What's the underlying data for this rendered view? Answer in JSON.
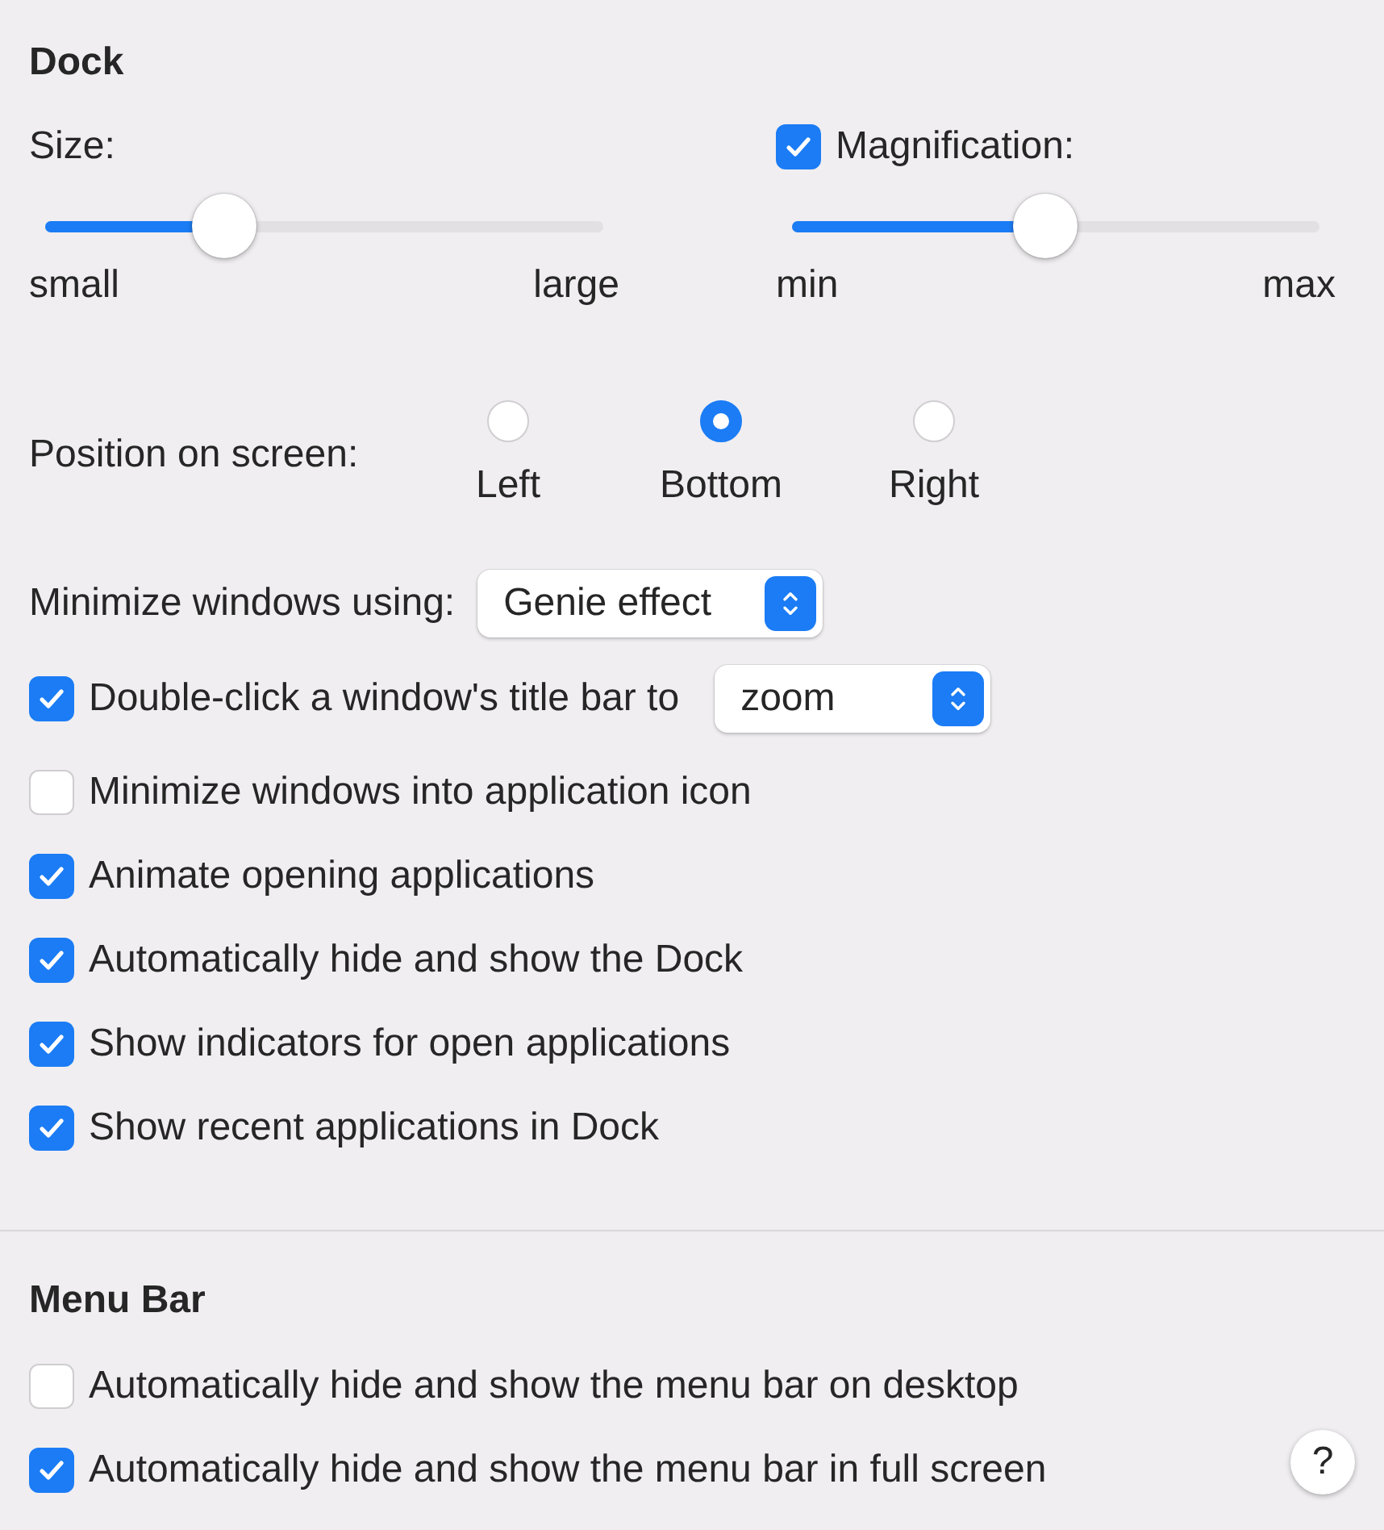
{
  "dock": {
    "title": "Dock",
    "size": {
      "label": "Size:",
      "level": 0.32,
      "min_label": "small",
      "max_label": "large"
    },
    "magnification": {
      "label": "Magnification:",
      "checked": true,
      "level": 0.48,
      "min_label": "min",
      "max_label": "max"
    },
    "position": {
      "label": "Position on screen:",
      "options": [
        {
          "label": "Left",
          "selected": false
        },
        {
          "label": "Bottom",
          "selected": true
        },
        {
          "label": "Right",
          "selected": false
        }
      ]
    },
    "minimize": {
      "label": "Minimize windows using:",
      "value": "Genie effect"
    },
    "double_click": {
      "label": "Double-click a window's title bar to",
      "checked": true,
      "value": "zoom"
    },
    "options": [
      {
        "label": "Minimize windows into application icon",
        "checked": false
      },
      {
        "label": "Animate opening applications",
        "checked": true
      },
      {
        "label": "Automatically hide and show the Dock",
        "checked": true
      },
      {
        "label": "Show indicators for open applications",
        "checked": true
      },
      {
        "label": "Show recent applications in Dock",
        "checked": true
      }
    ]
  },
  "menu_bar": {
    "title": "Menu Bar",
    "options": [
      {
        "label": "Automatically hide and show the menu bar on desktop",
        "checked": false
      },
      {
        "label": "Automatically hide and show the menu bar in full screen",
        "checked": true
      }
    ]
  },
  "help": {
    "label": "?"
  }
}
